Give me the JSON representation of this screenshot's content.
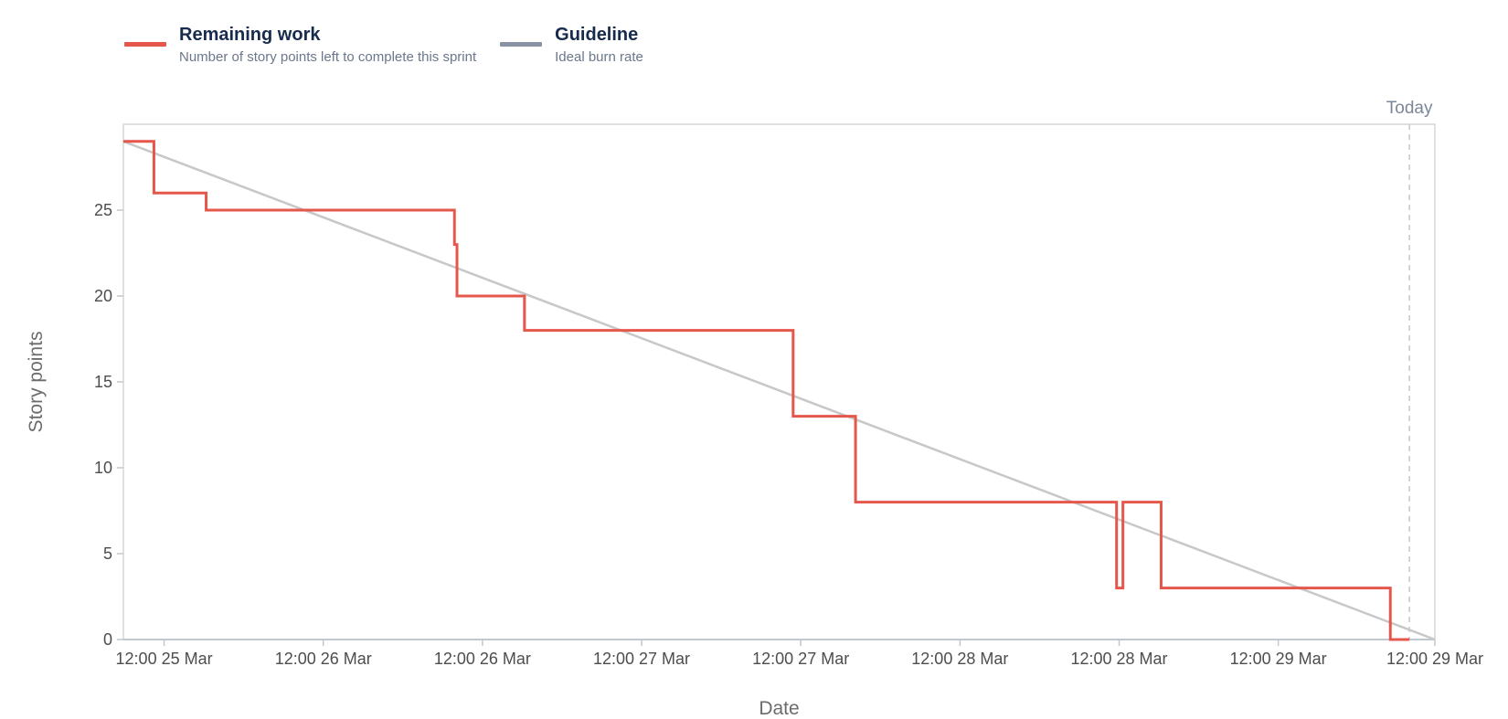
{
  "legend": {
    "remaining": {
      "title": "Remaining work",
      "desc": "Number of story points left to complete this sprint"
    },
    "guideline": {
      "title": "Guideline",
      "desc": "Ideal burn rate"
    }
  },
  "chart_data": {
    "type": "line",
    "title": "",
    "xlabel": "Date",
    "ylabel": "Story points",
    "x_unit": "hours since sprint start",
    "xlim": [
      0,
      103
    ],
    "ylim": [
      0,
      30
    ],
    "yticks": [
      0,
      5,
      10,
      15,
      20,
      25
    ],
    "xticks": [
      {
        "x": 3.2,
        "label": "12:00 25 Mar"
      },
      {
        "x": 15.7,
        "label": "12:00 26 Mar"
      },
      {
        "x": 28.2,
        "label": "12:00 26 Mar"
      },
      {
        "x": 40.7,
        "label": "12:00 27 Mar"
      },
      {
        "x": 53.2,
        "label": "12:00 27 Mar"
      },
      {
        "x": 65.7,
        "label": "12:00 28 Mar"
      },
      {
        "x": 78.2,
        "label": "12:00 28 Mar"
      },
      {
        "x": 90.7,
        "label": "12:00 29 Mar"
      },
      {
        "x": 103,
        "label": "12:00 29 Mar"
      }
    ],
    "today": {
      "x": 101,
      "label": "Today"
    },
    "grid": false,
    "legend_position": "top-left",
    "series": [
      {
        "name": "Remaining work",
        "color": "#e5574b",
        "step": true,
        "points": [
          [
            0,
            29
          ],
          [
            2.4,
            26
          ],
          [
            6.5,
            25
          ],
          [
            26.0,
            23
          ],
          [
            26.2,
            20
          ],
          [
            31.5,
            18
          ],
          [
            52.6,
            13
          ],
          [
            57.5,
            8
          ],
          [
            78.0,
            3
          ],
          [
            78.5,
            8
          ],
          [
            81.5,
            3
          ],
          [
            99.5,
            0
          ],
          [
            101,
            0
          ]
        ]
      },
      {
        "name": "Guideline",
        "color": "#c8c8c8",
        "points": [
          [
            0,
            29
          ],
          [
            103,
            0
          ]
        ]
      }
    ]
  },
  "colors": {
    "remaining_swatch": "#e5574b",
    "guideline_swatch": "#8993a4",
    "axis": "#c1c7d0"
  }
}
